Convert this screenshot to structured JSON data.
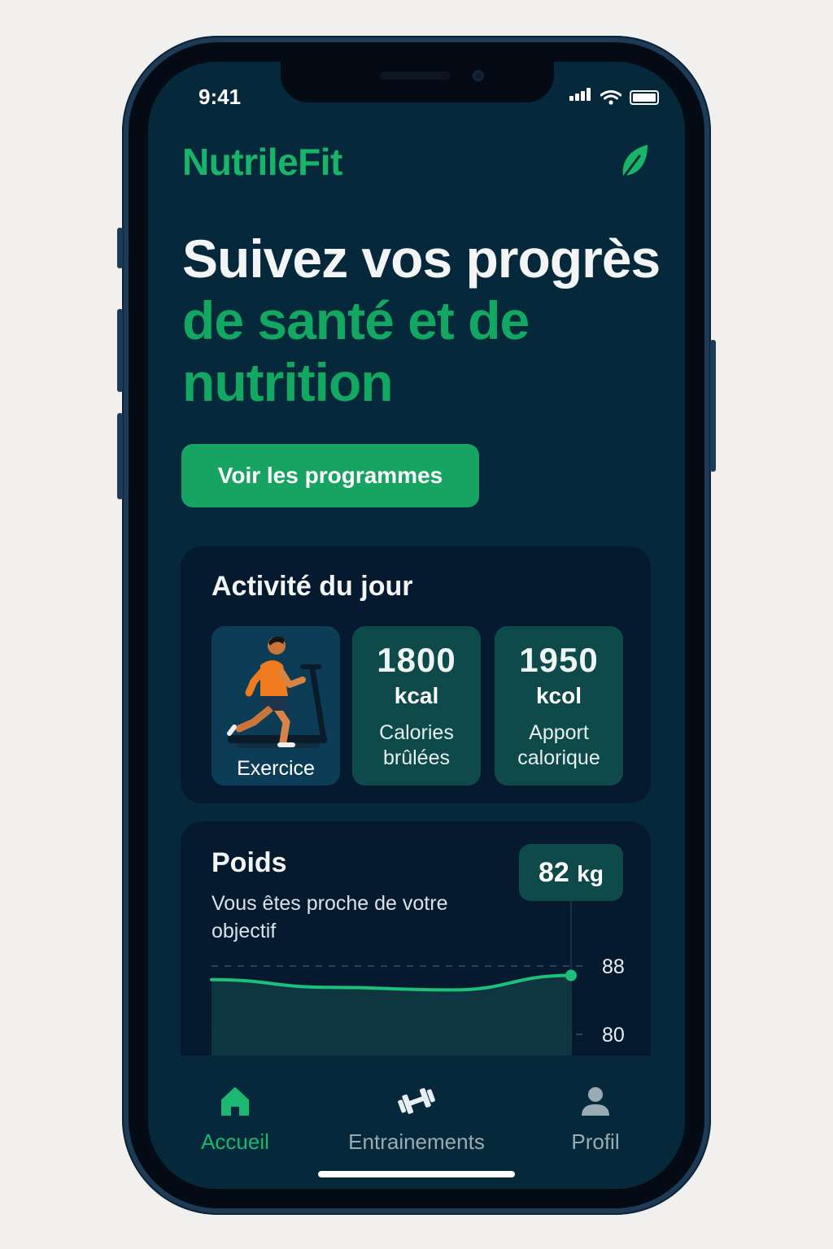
{
  "status_bar": {
    "time": "9:41"
  },
  "header": {
    "brand": "NutrileFit"
  },
  "hero": {
    "line1": "Suivez vos progrès",
    "line2": "de santé et de",
    "line3": "nutrition",
    "cta_label": "Voir les programmes"
  },
  "activity": {
    "title": "Activité du jour",
    "exercise_label": "Exercice",
    "burned": {
      "value": "1800",
      "unit": "kcal",
      "label_line1": "Calories",
      "label_line2": "brûlées"
    },
    "intake": {
      "value": "1950",
      "unit": "kcol",
      "label_line1": "Apport",
      "label_line2": "calorique"
    }
  },
  "weight": {
    "title": "Poids",
    "subtitle": "Vous êtes proche de votre objectif",
    "current_value": "82",
    "current_unit": "kg"
  },
  "chart_data": {
    "type": "area",
    "title": "",
    "xlabel": "",
    "ylabel": "",
    "y_ticks": [
      "88",
      "80"
    ],
    "ylim": [
      80,
      88
    ],
    "x": [
      0,
      1,
      2,
      3
    ],
    "series": [
      {
        "values": [
          86.4,
          85.5,
          85.2,
          86.9
        ]
      }
    ],
    "grid": true,
    "color": "#1cc07a"
  },
  "tabbar": {
    "items": [
      {
        "label": "Accueil",
        "icon": "home-icon",
        "active": true
      },
      {
        "label": "Entrainements",
        "icon": "dumbbell-icon",
        "active": false
      },
      {
        "label": "Profil",
        "icon": "profile-icon",
        "active": false
      }
    ]
  },
  "colors": {
    "accent": "#17a462",
    "background": "#05293a",
    "card": "#061a2f",
    "tile": "#0e4a4a"
  }
}
